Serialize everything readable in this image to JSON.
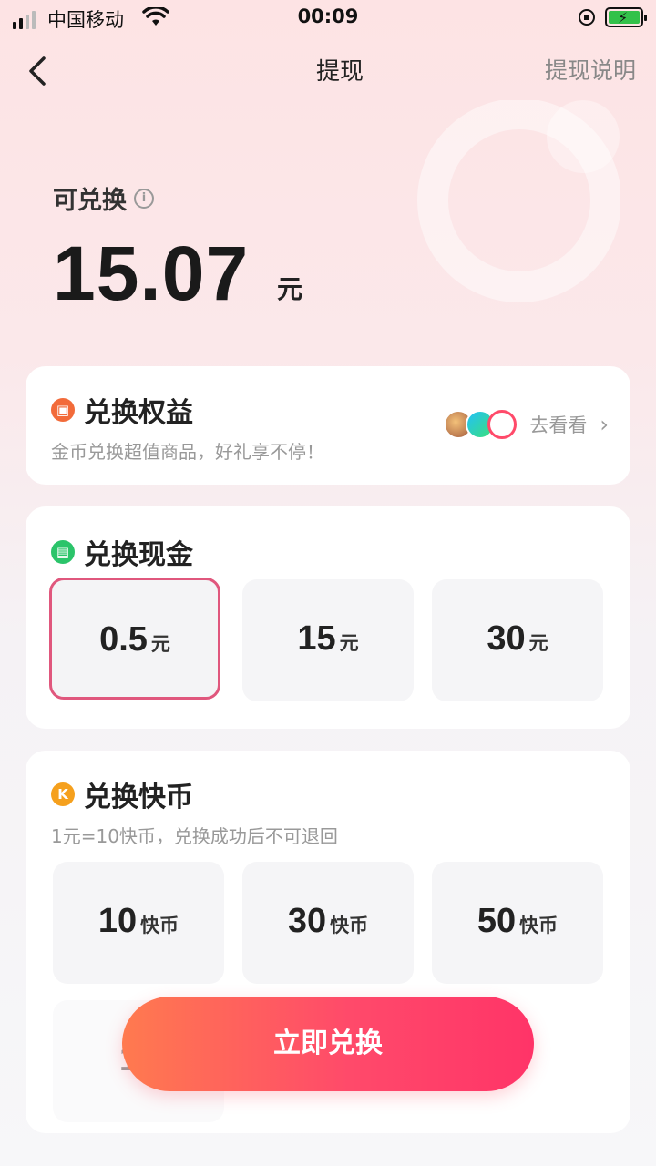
{
  "status_bar": {
    "carrier": "中国移动",
    "time": "00:09"
  },
  "nav": {
    "title": "提现",
    "help_link": "提现说明"
  },
  "balance": {
    "label": "可兑换",
    "amount": "15.07",
    "unit": "元"
  },
  "benefits": {
    "title": "兑换权益",
    "subtitle": "金币兑换超值商品，好礼享不停！",
    "link_text": "去看看",
    "icon_colors": [
      "#e96a4f",
      "#1fa4f1",
      "#ff4a6a"
    ]
  },
  "cash": {
    "title": "兑换现金",
    "options": [
      {
        "value": "0.5",
        "unit": "元",
        "selected": true
      },
      {
        "value": "15",
        "unit": "元"
      },
      {
        "value": "30",
        "unit": "元"
      }
    ]
  },
  "coins": {
    "title": "兑换快币",
    "badge": "K",
    "subtitle": "1元=10快币，兑换成功后不可退回",
    "options": [
      {
        "value": "10",
        "unit": "快币"
      },
      {
        "value": "30",
        "unit": "快币"
      },
      {
        "value": "50",
        "unit": "快币"
      },
      {
        "value": "10",
        "unit": ""
      }
    ]
  },
  "cta": {
    "label": "立即兑换"
  },
  "colors": {
    "accent": "#ff4a6a",
    "selected_border": "#e0577d",
    "cash_icon": "#2bc46a",
    "benefit_icon": "#f26b3a",
    "coin_icon": "#f5a01d"
  }
}
